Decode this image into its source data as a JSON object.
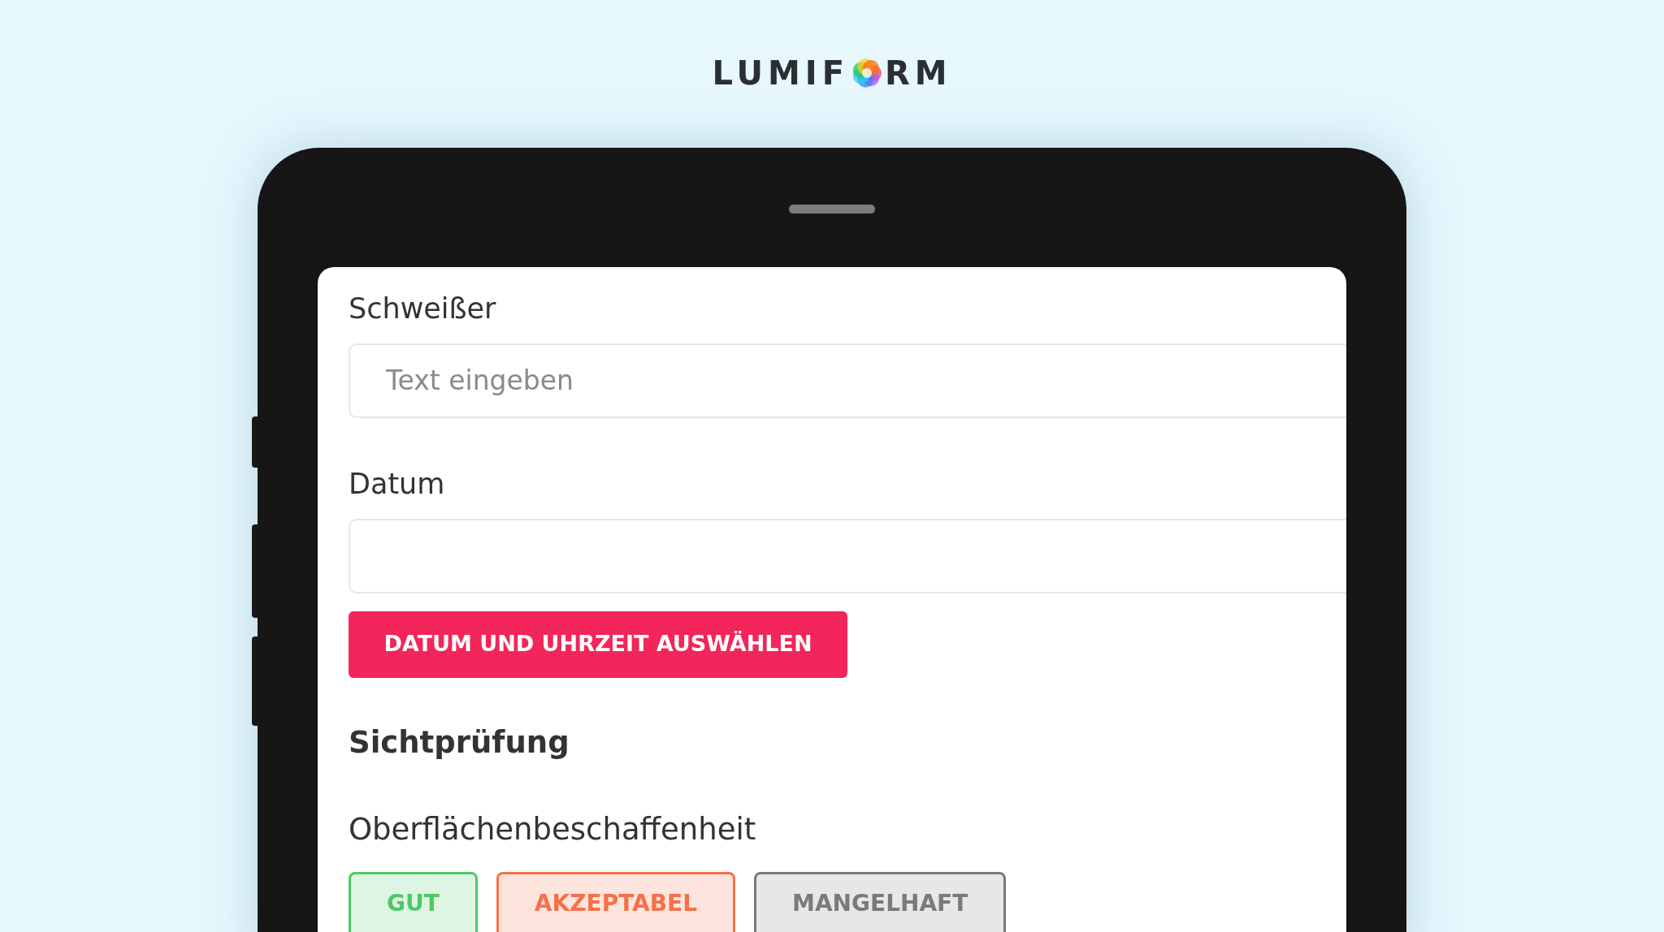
{
  "logo": {
    "before": "LUMIF",
    "after": "RM"
  },
  "form": {
    "fields": [
      {
        "label": "Schweißer",
        "placeholder": "Text eingeben"
      },
      {
        "label": "Datum"
      }
    ],
    "date_button": "DATUM UND UHRZEIT AUSWÄHLEN",
    "section": "Sichtprüfung",
    "question": "Oberflächenbeschaffenheit",
    "options": [
      {
        "label": "GUT",
        "color": "#4cc964"
      },
      {
        "label": "AKZEPTABEL",
        "color": "#f5714a"
      },
      {
        "label": "MANGELHAFT",
        "color": "#7a7a7a"
      }
    ]
  }
}
